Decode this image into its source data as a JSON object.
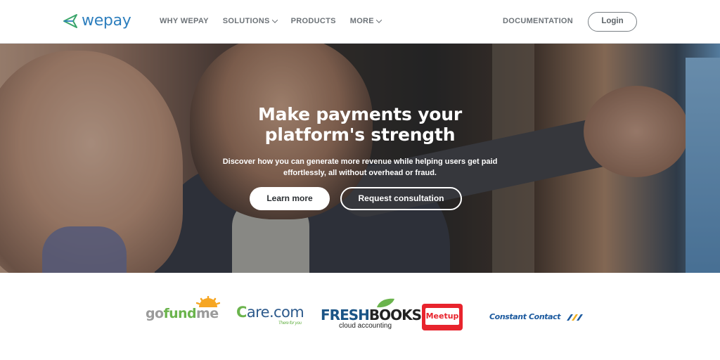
{
  "header": {
    "brand": "wepay",
    "nav": [
      {
        "label": "WHY WEPAY",
        "has_dropdown": false
      },
      {
        "label": "SOLUTIONS",
        "has_dropdown": true
      },
      {
        "label": "PRODUCTS",
        "has_dropdown": false
      },
      {
        "label": "MORE",
        "has_dropdown": true
      }
    ],
    "documentation": "DOCUMENTATION",
    "login": "Login"
  },
  "hero": {
    "title_line1": "Make payments your",
    "title_line2": "platform's strength",
    "subtitle_line1": "Discover how you can generate more revenue while helping users get paid",
    "subtitle_line2": "effortlessly, all without overhead or fraud.",
    "primary_button": "Learn more",
    "secondary_button": "Request consultation"
  },
  "logos": {
    "gofundme_go": "go",
    "gofundme_fund": "fund",
    "gofundme_me": "me",
    "care_c": "C",
    "care_rest": "are.com",
    "care_tagline": "There for you",
    "freshbooks_fresh": "FRESH",
    "freshbooks_books": "BOOKS",
    "freshbooks_sub": "cloud accounting",
    "meetup": "Meetup",
    "constant_contact": "Constant Contact"
  },
  "colors": {
    "brand_blue": "#2e7fbe",
    "nav_gray": "#6d7378",
    "gofundme_green": "#6bb44d",
    "meetup_red": "#e8242d",
    "constant_contact_blue": "#1c5a9f"
  }
}
